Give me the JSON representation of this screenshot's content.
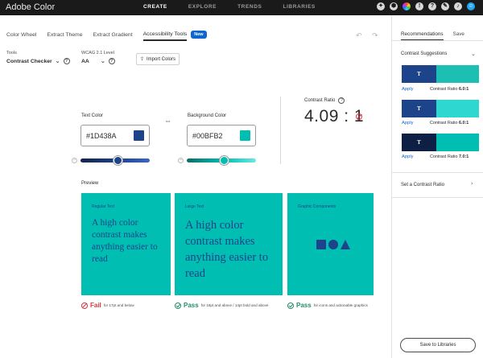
{
  "app": {
    "brand": "Adobe Color"
  },
  "topnav": [
    "CREATE",
    "EXPLORE",
    "TRENDS",
    "LIBRARIES"
  ],
  "topicons": {
    "notifications": "!",
    "help": "?"
  },
  "tabs": [
    {
      "label": "Color Wheel"
    },
    {
      "label": "Extract Theme"
    },
    {
      "label": "Extract Gradient"
    },
    {
      "label": "Accessibility Tools"
    }
  ],
  "new_badge": "New",
  "tools": {
    "label": "Tools",
    "value": "Contrast Checker"
  },
  "wcag": {
    "label": "WCAG 2.1 Level",
    "value": "AA"
  },
  "import_label": "Import Colors",
  "text_color": {
    "label": "Text Color",
    "hex": "#1D438A",
    "level": 0.6
  },
  "background_color": {
    "label": "Background Color",
    "hex": "#00BFB2",
    "level": 0.6
  },
  "contrast": {
    "label": "Contrast Ratio",
    "value": "4.09 : 1"
  },
  "preview": {
    "label": "Preview",
    "cards": [
      {
        "label": "Regular Text",
        "text": "A high color contrast makes anything easier to read"
      },
      {
        "label": "Large Text",
        "text": "A high color contrast makes anything easier to read"
      },
      {
        "label": "Graphic Components"
      }
    ],
    "status": [
      {
        "word": "Fail",
        "desc": "for 17pt and below",
        "color": "#d7373f"
      },
      {
        "word": "Pass",
        "desc": "for 18pt and above / 14pt bold and above",
        "color": "#268e6c"
      },
      {
        "word": "Pass",
        "desc": "for icons and actionable graphics",
        "color": "#268e6c"
      }
    ]
  },
  "sidebar": {
    "tabs": [
      "Recommendations",
      "Save"
    ],
    "suggestions_label": "Contrast Suggestions",
    "pairs": [
      {
        "letter": "T",
        "left": "#1D438A",
        "right": "#1DBFB2",
        "apply": "Apply",
        "ratio_label": "Contrast Ratio",
        "ratio": "6.0:1"
      },
      {
        "letter": "T",
        "left": "#1D438A",
        "right": "#2ED8D0",
        "apply": "Apply",
        "ratio_label": "Contrast Ratio",
        "ratio": "6.0:1"
      },
      {
        "letter": "T",
        "left": "#0E1F45",
        "right": "#00BFB2",
        "apply": "Apply",
        "ratio_label": "Contrast Ratio",
        "ratio": "7.0:1"
      }
    ],
    "set_ratio_label": "Set a Contrast Ratio",
    "save_button": "Save to Libraries"
  }
}
